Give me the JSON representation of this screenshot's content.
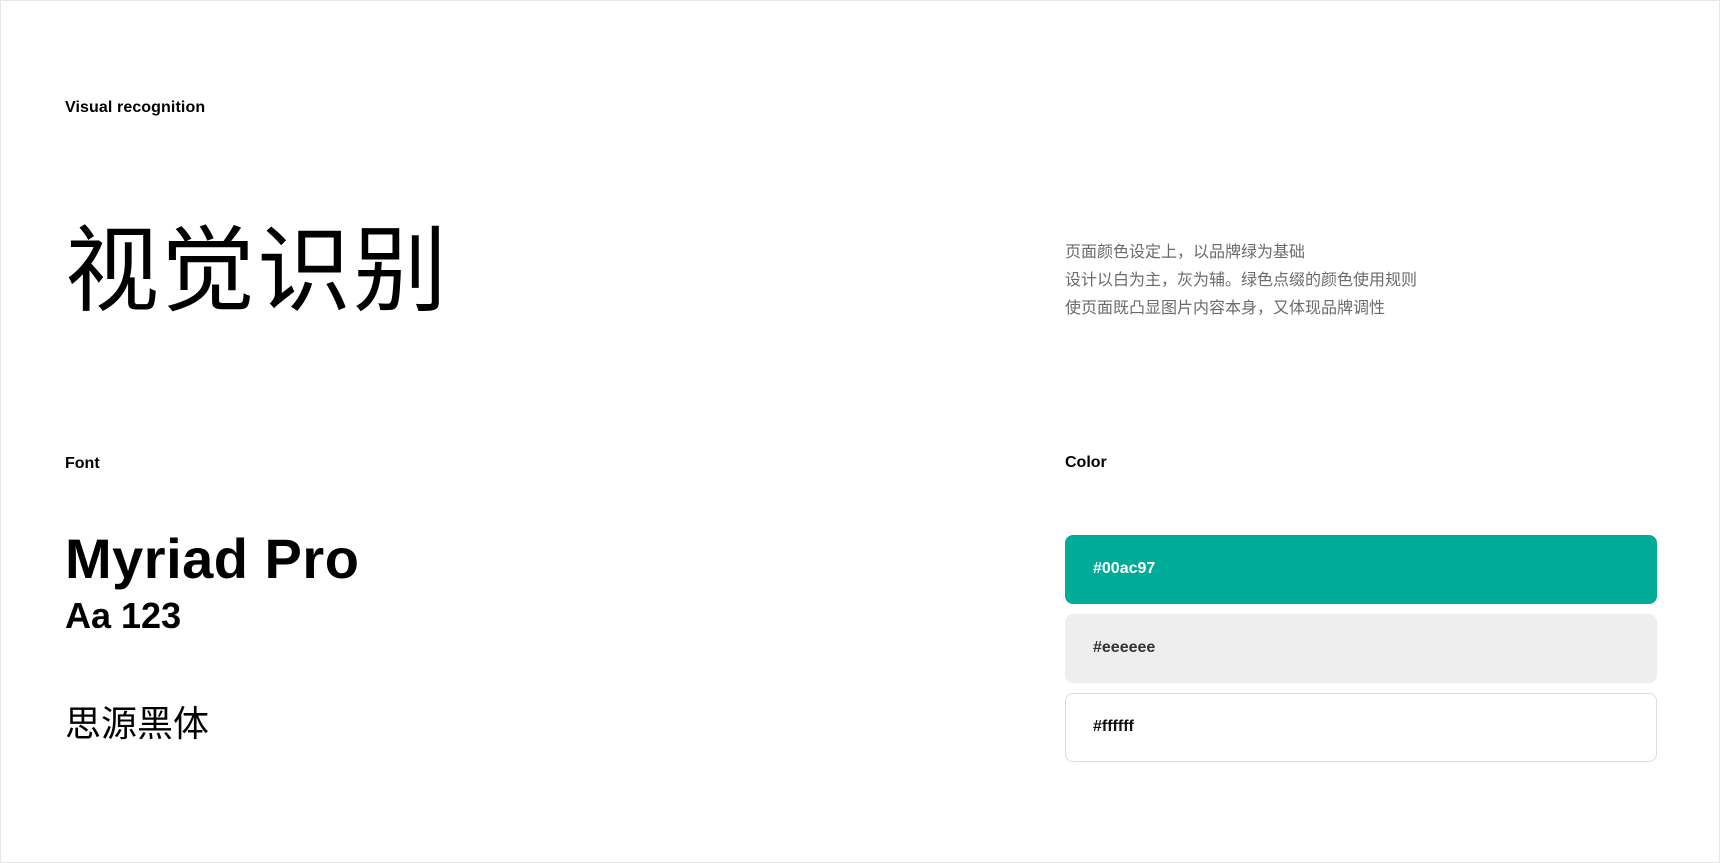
{
  "header": {
    "eyebrow": "Visual recognition",
    "title": "视觉识别"
  },
  "intro": {
    "lines": [
      "页面颜色设定上，以品牌绿为基础",
      "设计以白为主，灰为辅。绿色点缀的颜色使用规则",
      "使页面既凸显图片内容本身，又体现品牌调性"
    ]
  },
  "font": {
    "label": "Font",
    "primary_name": "Myriad Pro",
    "primary_sample": "Aa 123",
    "secondary_name": "思源黑体"
  },
  "color": {
    "label": "Color",
    "swatches": [
      {
        "hex": "#00ac97",
        "fill": "#00ac97"
      },
      {
        "hex": "#eeeeee",
        "fill": "#eeeeee"
      },
      {
        "hex": "#ffffff",
        "fill": "#ffffff"
      }
    ]
  }
}
